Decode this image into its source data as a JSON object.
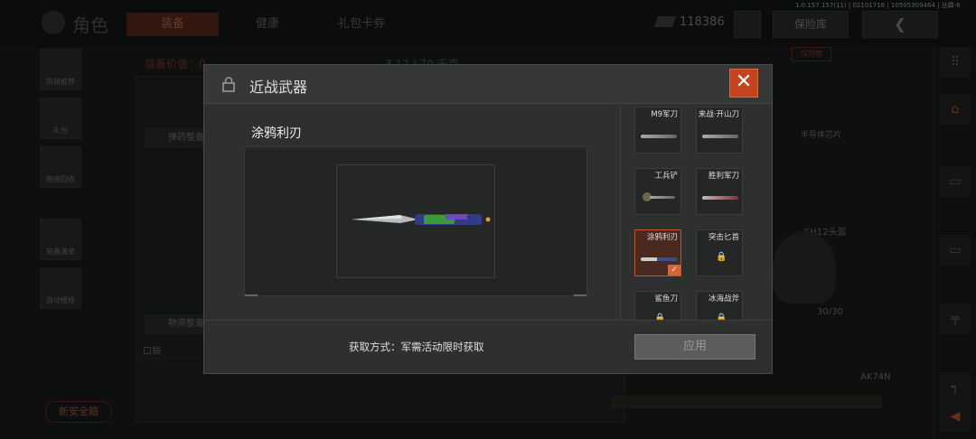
{
  "background": {
    "title": "角色",
    "tabs": [
      {
        "label": "装备",
        "active": true
      },
      {
        "label": "健康",
        "active": false
      },
      {
        "label": "礼包卡券",
        "active": false
      }
    ],
    "currency": "118386",
    "vault_label": "保险库",
    "vault_tag": "保险库",
    "debug_info": "1.0.157.157(11) | 02101716 | 10505309464 | 丛霖-6",
    "equip_value_label": "装备价值：0",
    "capacity": "3.12 / 70 千克",
    "side_buttons": [
      "防骑推荐",
      "礼包",
      "物资回收",
      "装备清单",
      "自动维修"
    ],
    "ammo_label": "弹药整备",
    "supply_label": "物资整备",
    "pocket_label": "口袋",
    "safe_btn": "新安全箱",
    "chip_label": "半导体芯片",
    "helmet_label": "SH12头盔",
    "helmet_dur": "30/30",
    "gun_label": "AK74N"
  },
  "modal": {
    "title": "近战武器",
    "close_icon": "close-icon",
    "item_name": "涂鸦利刃",
    "items": [
      {
        "label": "M9军刀",
        "locked": false,
        "selected": false
      },
      {
        "label": "来战·开山刀",
        "locked": false,
        "selected": false
      },
      {
        "label": "工兵铲",
        "locked": false,
        "selected": false
      },
      {
        "label": "胜利军刀",
        "locked": false,
        "selected": false
      },
      {
        "label": "涂鸦利刃",
        "locked": false,
        "selected": true
      },
      {
        "label": "突击匕首",
        "locked": true,
        "selected": false
      },
      {
        "label": "鲨鱼刀",
        "locked": true,
        "selected": false
      },
      {
        "label": "冰海战斧",
        "locked": true,
        "selected": false
      }
    ],
    "acquire_text": "获取方式：军需活动限时获取",
    "apply_label": "应用"
  },
  "colors": {
    "accent": "#c4441f",
    "selected_border": "#c4532a"
  }
}
